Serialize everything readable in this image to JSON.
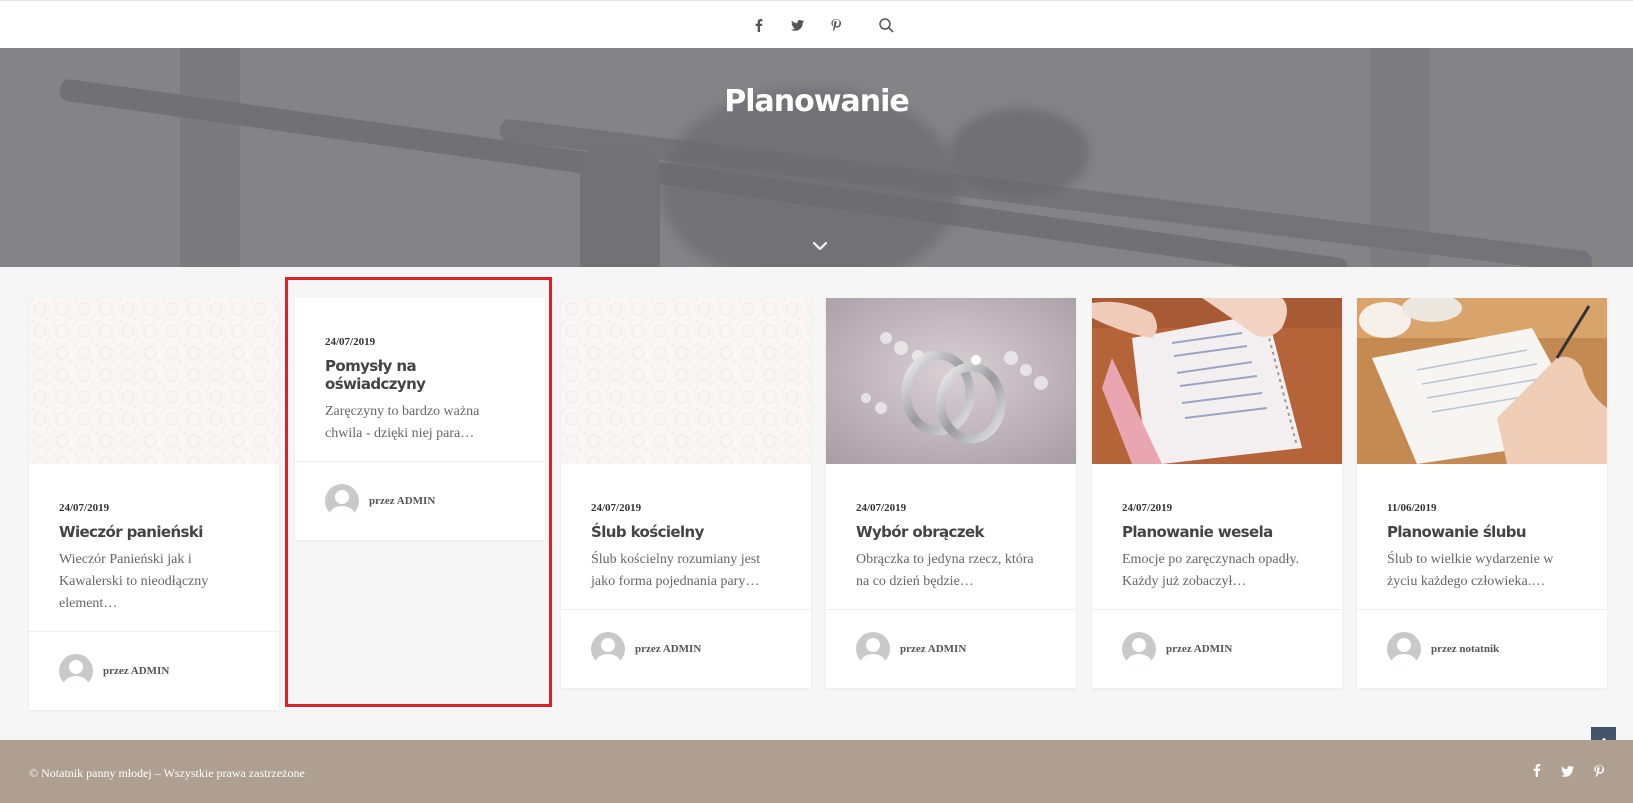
{
  "header": {
    "social": [
      "facebook-icon",
      "twitter-icon",
      "pinterest-icon",
      "search-icon"
    ]
  },
  "hero": {
    "title": "Planowanie"
  },
  "posts": [
    {
      "date": "24/07/2019",
      "title": "Wieczór panieński",
      "excerpt": "Wieczór Panieński jak i Kawalerski to nieodłączny element…",
      "author": "przez ADMIN",
      "image": "placeholder-pattern"
    },
    {
      "date": "24/07/2019",
      "title": "Pomysły na oświadczyny",
      "excerpt": "Zaręczyny to bardzo ważna chwila - dzięki niej para…",
      "author": "przez ADMIN",
      "image": "none"
    },
    {
      "date": "24/07/2019",
      "title": "Ślub kościelny",
      "excerpt": "Ślub kościelny rozumiany jest jako forma pojednania pary…",
      "author": "przez ADMIN",
      "image": "placeholder-pattern"
    },
    {
      "date": "24/07/2019",
      "title": "Wybór obrączek",
      "excerpt": "Obrączka to jedyna rzecz, która na co dzień będzie…",
      "author": "przez ADMIN",
      "image": "wedding-rings"
    },
    {
      "date": "24/07/2019",
      "title": "Planowanie wesela",
      "excerpt": "Emocje po zaręczynach opadły. Każdy już zobaczył…",
      "author": "przez ADMIN",
      "image": "notebook-hands"
    },
    {
      "date": "11/06/2019",
      "title": "Planowanie ślubu",
      "excerpt": "Ślub to wielkie wydarzenie w życiu każdego człowieka.…",
      "author": "przez notatnik",
      "image": "writing-notebook"
    }
  ],
  "footer": {
    "copyright": "© Notatnik panny młodej – Wszystkie prawa zastrzeżone",
    "social": [
      "facebook-icon",
      "twitter-icon",
      "pinterest-icon"
    ]
  },
  "colors": {
    "highlight": "#d9222a",
    "footer_bg": "#ae9f90",
    "back_to_top": "#44546b"
  }
}
